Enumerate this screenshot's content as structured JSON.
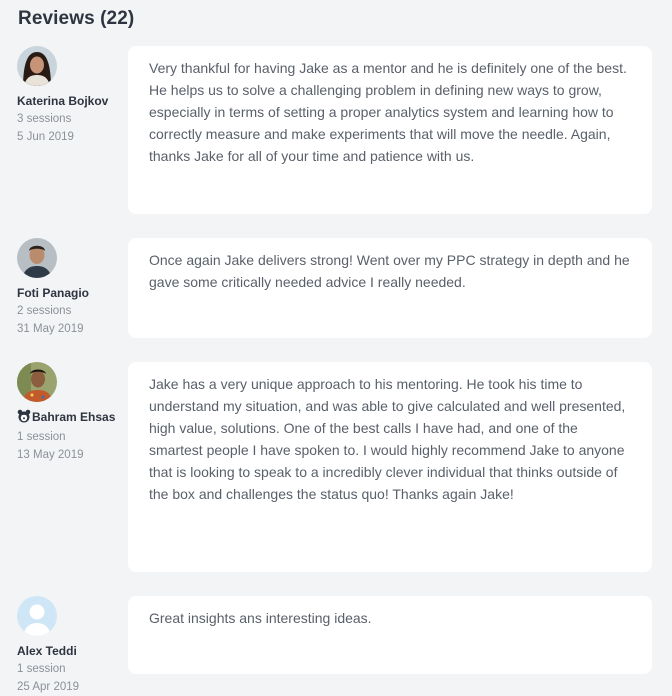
{
  "header": {
    "title": "Reviews (22)"
  },
  "reviews": [
    {
      "name": "Katerina Bojkov",
      "sessions": "3 sessions",
      "date": "5 Jun 2019",
      "text": "Very thankful for having Jake as a mentor and he is definitely one of the best. He helps us to solve a challenging problem in defining new ways to grow, especially in terms of setting a proper analytics system and learning how to correctly measure and make experiments that will move the needle. Again, thanks Jake for all of your time and patience with us."
    },
    {
      "name": "Foti Panagio",
      "sessions": "2 sessions",
      "date": "31 May 2019",
      "text": "Once again Jake delivers strong! Went over my PPC strategy in depth and he gave some critically needed advice I really needed."
    },
    {
      "name": "Bahram Ehsas",
      "sessions": "1 session",
      "date": "13 May 2019",
      "text": "Jake has a very unique approach to his mentoring. He took his time to understand my situation, and was able to give calculated and well presented, high value, solutions. One of the best calls I have had, and one of the smartest people I have spoken to. I would highly recommend Jake to anyone that is looking to speak to a incredibly clever individual that thinks outside of the box and challenges the status quo! Thanks again Jake!"
    },
    {
      "name": "Alex Teddi",
      "sessions": "1 session",
      "date": "25 Apr 2019",
      "text": "Great insights ans interesting ideas."
    }
  ]
}
